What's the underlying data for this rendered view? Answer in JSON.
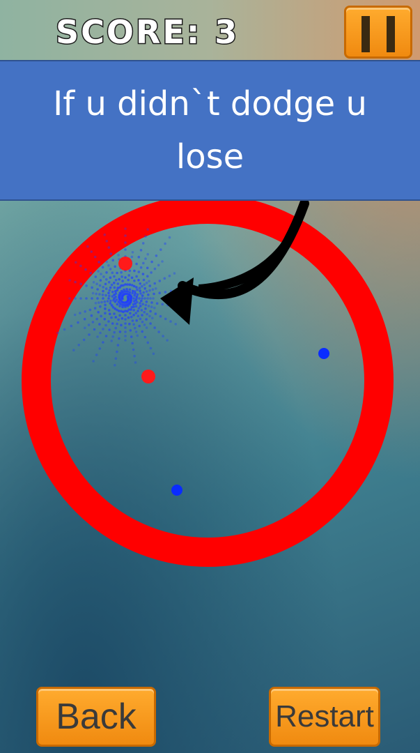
{
  "hud": {
    "score_text": "SCORE: 3",
    "pause_icon": "pause-icon"
  },
  "banner": {
    "text": "If u didn`t dodge u lose"
  },
  "buttons": {
    "back_label": "Back",
    "restart_label": "Restart"
  },
  "colors": {
    "ring": "#ff0000",
    "enemy_dot": "#ff1a1a",
    "player_dot": "#0a2cff",
    "banner": "#4472c4",
    "button_orange": "#f59a1e"
  }
}
